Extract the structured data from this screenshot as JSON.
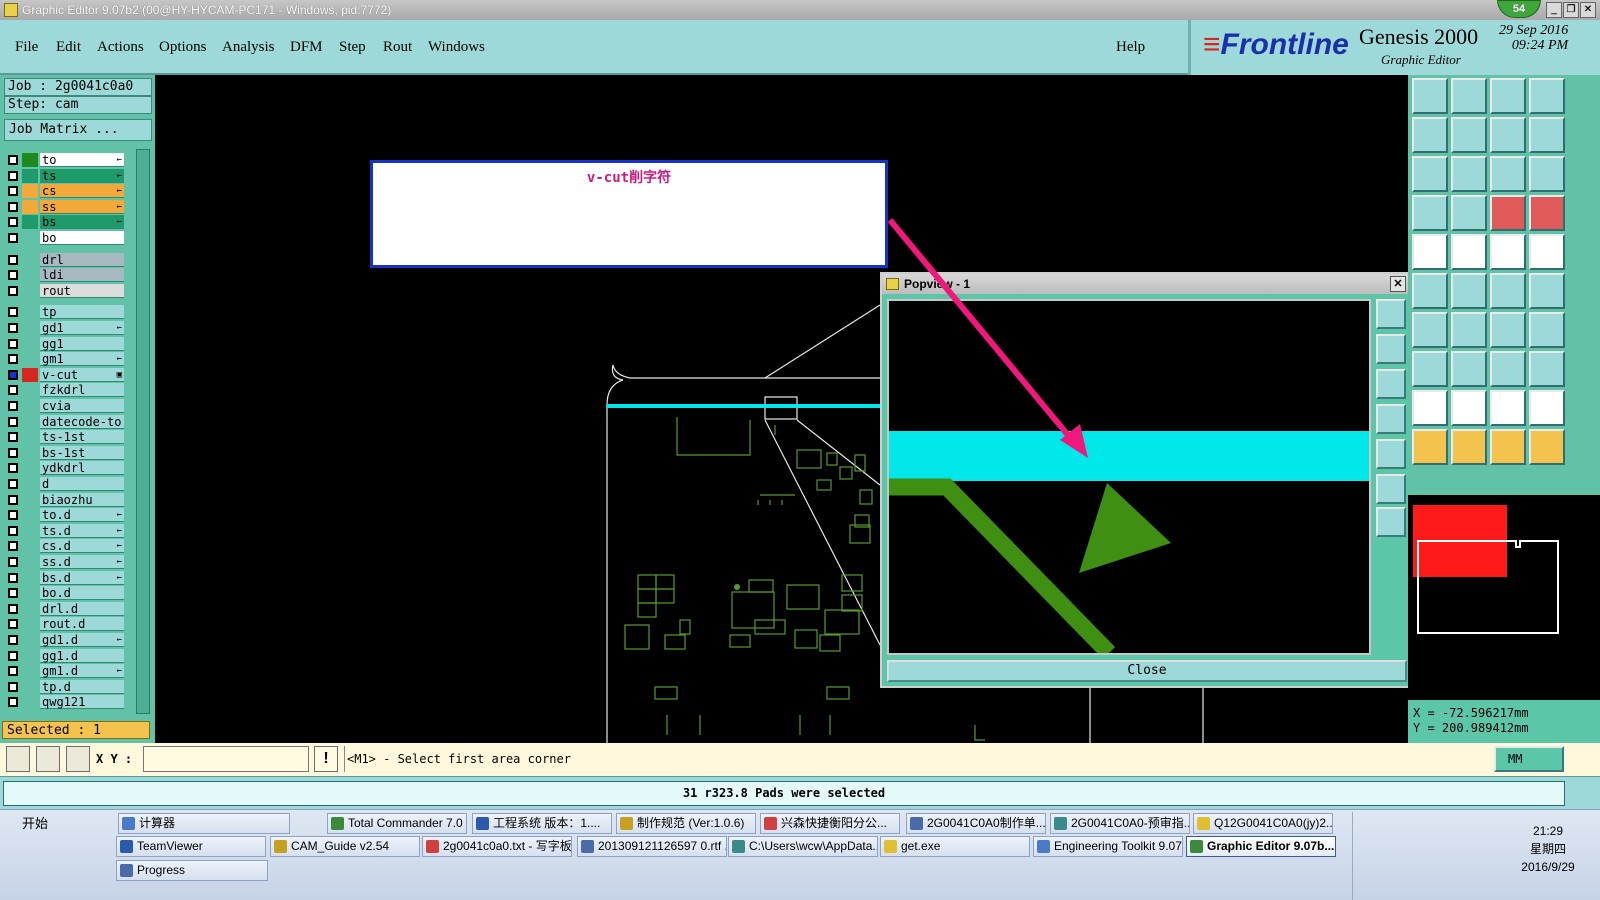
{
  "window": {
    "title": "Graphic Editor 9.07b2 (00@HY-HYCAM-PC171 - Windows, pid:7772)",
    "notification_count": "54"
  },
  "menu": {
    "items": [
      "File",
      "Edit",
      "Actions",
      "Options",
      "Analysis",
      "DFM",
      "Step",
      "Rout",
      "Windows"
    ],
    "help": "Help"
  },
  "brand": {
    "logo": "Frontline",
    "product": "Genesis 2000",
    "subtitle": "Graphic Editor",
    "date": "29 Sep 2016",
    "time": "09:24 PM"
  },
  "job": {
    "job_line": "Job : 2g0041c0a0",
    "step_line": "Step: cam",
    "matrix_button": "Job Matrix ..."
  },
  "layers": [
    {
      "name": "to",
      "color": "#ffffff",
      "swatch": "#1e8a1e",
      "mark": "←"
    },
    {
      "name": "ts",
      "color": "#1f9a6a",
      "swatch": "#1f9a6a",
      "mark": "←"
    },
    {
      "name": "cs",
      "color": "#f3a83a",
      "swatch": "#f3a83a",
      "mark": "←"
    },
    {
      "name": "ss",
      "color": "#f3a83a",
      "swatch": "#f3a83a",
      "mark": "←"
    },
    {
      "name": "bs",
      "color": "#1f9a6a",
      "swatch": "#1f9a6a",
      "mark": "←"
    },
    {
      "name": "bo",
      "color": "#ffffff",
      "swatch": "#62c2a8",
      "mark": ""
    },
    {
      "name": "drl",
      "color": "#a7b8c0",
      "swatch": "#62c2a8",
      "mark": ""
    },
    {
      "name": "ldi",
      "color": "#a7b8c0",
      "swatch": "#62c2a8",
      "mark": ""
    },
    {
      "name": "rout",
      "color": "#dcdcdc",
      "swatch": "#62c2a8",
      "mark": ""
    },
    {
      "name": "tp",
      "color": "#9ed9d9",
      "swatch": "#62c2a8",
      "mark": ""
    },
    {
      "name": "gd1",
      "color": "#9ed9d9",
      "swatch": "#62c2a8",
      "mark": "←"
    },
    {
      "name": "gg1",
      "color": "#9ed9d9",
      "swatch": "#62c2a8",
      "mark": ""
    },
    {
      "name": "gm1",
      "color": "#9ed9d9",
      "swatch": "#62c2a8",
      "mark": "←"
    },
    {
      "name": "v-cut",
      "color": "#9ed9d9",
      "swatch": "#d8261e",
      "mark": "▣"
    },
    {
      "name": "fzkdrl",
      "color": "#9ed9d9",
      "swatch": "#62c2a8",
      "mark": ""
    },
    {
      "name": "cvia",
      "color": "#9ed9d9",
      "swatch": "#62c2a8",
      "mark": ""
    },
    {
      "name": "datecode-to",
      "color": "#9ed9d9",
      "swatch": "#62c2a8",
      "mark": ""
    },
    {
      "name": "ts-1st",
      "color": "#9ed9d9",
      "swatch": "#62c2a8",
      "mark": ""
    },
    {
      "name": "bs-1st",
      "color": "#9ed9d9",
      "swatch": "#62c2a8",
      "mark": ""
    },
    {
      "name": "ydkdrl",
      "color": "#9ed9d9",
      "swatch": "#62c2a8",
      "mark": ""
    },
    {
      "name": "d",
      "color": "#9ed9d9",
      "swatch": "#62c2a8",
      "mark": ""
    },
    {
      "name": "biaozhu",
      "color": "#9ed9d9",
      "swatch": "#62c2a8",
      "mark": ""
    },
    {
      "name": "to.d",
      "color": "#9ed9d9",
      "swatch": "#62c2a8",
      "mark": "←"
    },
    {
      "name": "ts.d",
      "color": "#9ed9d9",
      "swatch": "#62c2a8",
      "mark": "←"
    },
    {
      "name": "cs.d",
      "color": "#9ed9d9",
      "swatch": "#62c2a8",
      "mark": "←"
    },
    {
      "name": "ss.d",
      "color": "#9ed9d9",
      "swatch": "#62c2a8",
      "mark": "←"
    },
    {
      "name": "bs.d",
      "color": "#9ed9d9",
      "swatch": "#62c2a8",
      "mark": "←"
    },
    {
      "name": "bo.d",
      "color": "#9ed9d9",
      "swatch": "#62c2a8",
      "mark": ""
    },
    {
      "name": "drl.d",
      "color": "#9ed9d9",
      "swatch": "#62c2a8",
      "mark": ""
    },
    {
      "name": "rout.d",
      "color": "#9ed9d9",
      "swatch": "#62c2a8",
      "mark": ""
    },
    {
      "name": "gd1.d",
      "color": "#9ed9d9",
      "swatch": "#62c2a8",
      "mark": "←"
    },
    {
      "name": "gg1.d",
      "color": "#9ed9d9",
      "swatch": "#62c2a8",
      "mark": ""
    },
    {
      "name": "gm1.d",
      "color": "#9ed9d9",
      "swatch": "#62c2a8",
      "mark": "←"
    },
    {
      "name": "tp.d",
      "color": "#9ed9d9",
      "swatch": "#62c2a8",
      "mark": ""
    },
    {
      "name": "qwg121",
      "color": "#9ed9d9",
      "swatch": "#62c2a8",
      "mark": ""
    }
  ],
  "selected_line": "Selected : 1",
  "annotation": {
    "text": "v-cut削字符"
  },
  "popview": {
    "title": "Popview - 1",
    "close_label": "Close"
  },
  "coords": {
    "x_line": "X = -72.596217mm",
    "y_line": "Y = 200.989412mm"
  },
  "command": {
    "xy_label": "X Y :",
    "xy_value": "",
    "prompt": "<M1> - Select first area corner",
    "units": "MM"
  },
  "status": "31 r323.8 Pads were selected",
  "colors": {
    "cyan_trace": "#00e8ea",
    "pad_green": "#3e8f12",
    "arrow": "#f0187a"
  },
  "taskbar": {
    "start": "开始",
    "row1": [
      "计算器",
      "Total Commander 7.0 ...",
      "工程系统  版本：1....",
      "制作规范 (Ver:1.0.6)",
      "兴森快捷衡阳分公...",
      "2G0041C0A0制作单....",
      "2G0041C0A0-预审指...",
      "Q12G0041C0A0(jy)2...."
    ],
    "row2": [
      "TeamViewer",
      "CAM_Guide v2.54",
      "2g0041c0a0.txt - 写字板",
      "201309121126597 0.rtf ...",
      "C:\\Users\\wcw\\AppData...",
      "get.exe",
      "Engineering Toolkit 9.07...",
      "Graphic Editor 9.07b..."
    ],
    "row3": [
      "Progress"
    ],
    "clock_time": "21:29",
    "clock_day": "星期四",
    "clock_date": "2016/9/29"
  }
}
